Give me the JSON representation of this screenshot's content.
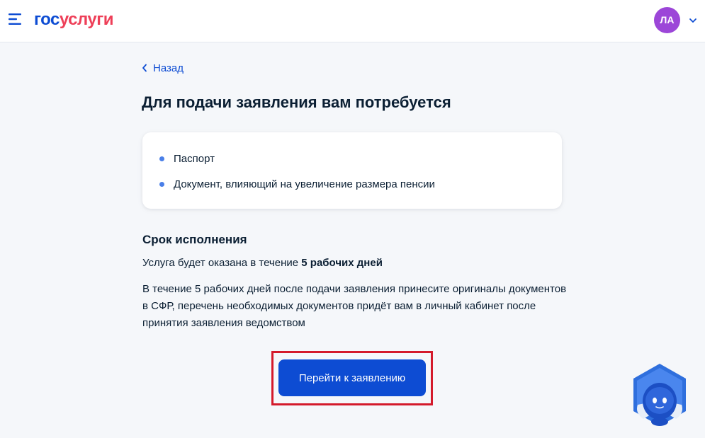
{
  "header": {
    "logo_part1": "гос",
    "logo_part2": "услуги",
    "avatar_initials": "ЛА",
    "menu_icon": "hamburger-menu-icon",
    "chevron_icon": "chevron-down-icon"
  },
  "back_label": "Назад",
  "title": "Для подачи заявления вам потребуется",
  "documents": [
    "Паспорт",
    "Документ, влияющий на увеличение размера пенсии"
  ],
  "term": {
    "heading": "Срок исполнения",
    "line_prefix": "Услуга будет оказана в течение ",
    "line_bold": "5 рабочих дней",
    "note": "В течение 5 рабочих дней после подачи заявления принесите оригиналы документов в СФР, перечень необходимых документов придёт вам в личный кабинет после принятия заявления ведомством"
  },
  "button_label": "Перейти к заявлению",
  "colors": {
    "brand_blue": "#0d4cd3",
    "brand_red": "#ee3f58",
    "avatar_bg": "#9c46d8",
    "highlight": "#d41a2b"
  },
  "assistant_icon": "robot-assistant-icon"
}
